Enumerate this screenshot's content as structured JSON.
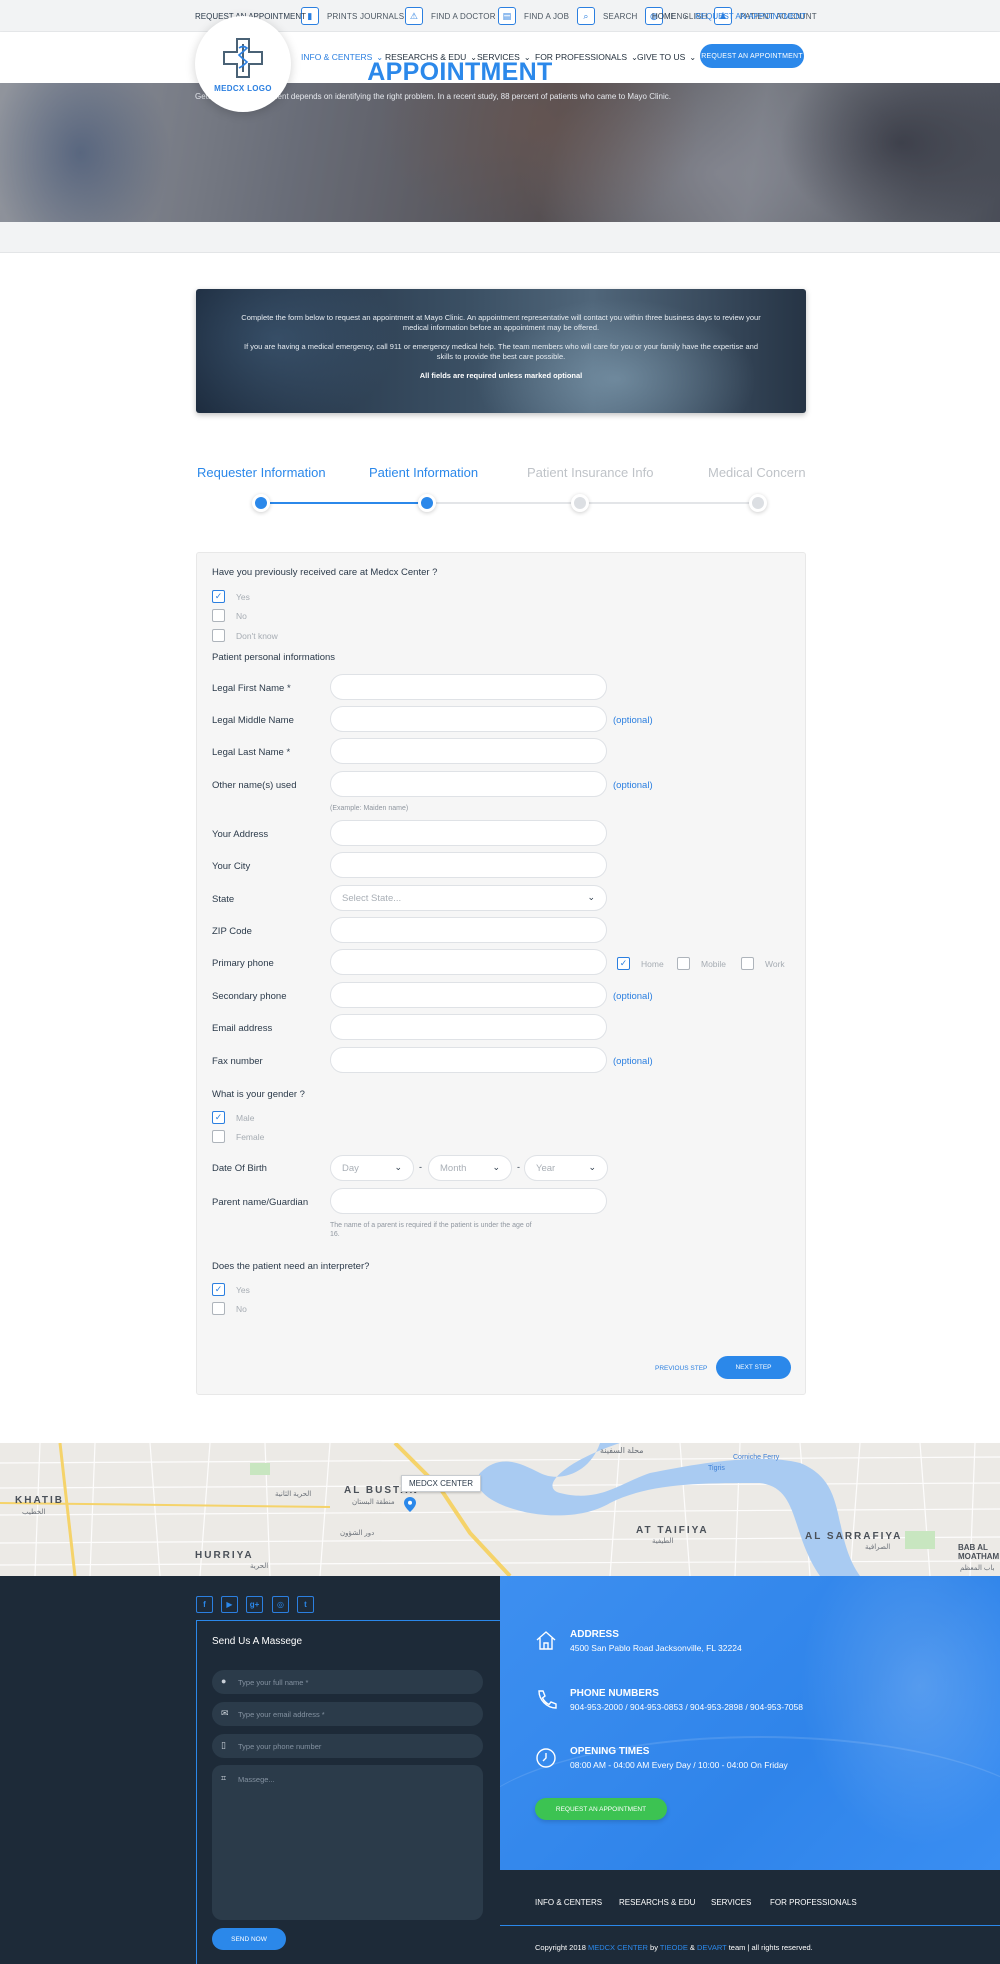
{
  "colors": {
    "accent": "#2b88ea",
    "dark": "#1d2a38",
    "green": "#3cc352"
  },
  "utility": [
    {
      "label": "PRINTS JOURNALS",
      "icon": "book-icon"
    },
    {
      "label": "FIND A DOCTOR",
      "icon": "doctor-icon"
    },
    {
      "label": "FIND A JOB",
      "icon": "document-icon"
    },
    {
      "label": "SEARCH",
      "icon": "search-icon"
    },
    {
      "label": "ENGLISH",
      "icon": "globe-icon"
    },
    {
      "label": "PATIENT ACCOUNT",
      "icon": "user-icon"
    }
  ],
  "logo": {
    "text": "MEDCX LOGO"
  },
  "nav": {
    "items": [
      "INFO & CENTERS",
      "RESEARCHS & EDU",
      "SERVICES",
      "FOR PROFESSIONALS",
      "GIVE TO US"
    ],
    "active": "INFO & CENTERS",
    "cta": "REQUEST AN APPOINTMENT"
  },
  "hero": {
    "title_main": "REQUEST AN ",
    "title_accent": "APPOINTMENT",
    "subtitle": "Getting effective treatment depends on identifying the right problem. In a recent study, 88 percent of patients who came to Mayo Clinic."
  },
  "breadcrumb": {
    "page": "REQUEST AN APPOINTMENT",
    "home": "HOME",
    "current": "REQUEST AN APPOINTMENT"
  },
  "intro": {
    "p1": "Complete the form below to request an appointment at Mayo Clinic. An appointment representative will contact you within three business days to review your medical information before an appointment may be offered.",
    "p2": "If you are having a medical emergency, call 911 or emergency medical help. The team members who will care for you or your family have the expertise and skills to provide the best care possible.",
    "p3": "All fields are required unless marked optional"
  },
  "steps": [
    {
      "label": "Requester Information",
      "active": true
    },
    {
      "label": "Patient Information",
      "active": true
    },
    {
      "label": "Patient Insurance Info",
      "active": false
    },
    {
      "label": "Medical Concern",
      "active": false
    }
  ],
  "form": {
    "q_previous_care": "Have you previously received care at Medcx Center ?",
    "care_options": [
      {
        "label": "Yes",
        "checked": true
      },
      {
        "label": "No",
        "checked": false
      },
      {
        "label": "Don't know",
        "checked": false
      }
    ],
    "section_personal": "Patient personal informations",
    "fields": {
      "first_name": "Legal First Name *",
      "middle_name": "Legal Middle Name",
      "last_name": "Legal Last Name *",
      "other_names": "Other name(s) used",
      "other_names_hint": "(Example: Maiden name)",
      "address": "Your Address",
      "city": "Your City",
      "state": "State",
      "state_placeholder": "Select State...",
      "zip": "ZIP Code",
      "primary_phone": "Primary phone",
      "secondary_phone": "Secondary phone",
      "email": "Email address",
      "fax": "Fax number",
      "dob": "Date Of Birth",
      "guardian": "Parent name/Guardian",
      "guardian_hint": "The name of a parent is required if the patient is under the age of 16."
    },
    "optional_label": "(optional)",
    "phone_types": [
      {
        "label": "Home",
        "checked": true
      },
      {
        "label": "Mobile",
        "checked": false
      },
      {
        "label": "Work",
        "checked": false
      }
    ],
    "q_gender": "What is your gender ?",
    "gender_options": [
      {
        "label": "Male",
        "checked": true
      },
      {
        "label": "Female",
        "checked": false
      }
    ],
    "dob_selects": {
      "day": "Day",
      "month": "Month",
      "year": "Year",
      "sep": "-"
    },
    "q_interpreter": "Does the patient need an interpreter?",
    "interpreter_options": [
      {
        "label": "Yes",
        "checked": true
      },
      {
        "label": "No",
        "checked": false
      }
    ],
    "prev_step": "PREVIOUS STEP",
    "next_step": "NEXT STEP"
  },
  "map": {
    "callout": "MEDCX CENTER",
    "labels": [
      "KHATIB",
      "الخطيب",
      "AL BUSTAN",
      "منطقة البستان",
      "HURRIYA",
      "الحرية",
      "AT TAIFIYA",
      "الطيفية",
      "AL SARRAFIYA",
      "الصرافية",
      "BAB AL MOATHAM",
      "باب المعظم",
      "محلة السفينة",
      "الحرية الثانية",
      "دور الشؤون",
      "Corniche Ferry",
      "Tigris"
    ]
  },
  "footer": {
    "social": [
      {
        "icon": "facebook-icon",
        "glyph": "f"
      },
      {
        "icon": "youtube-icon",
        "glyph": "▶"
      },
      {
        "icon": "google-plus-icon",
        "glyph": "g+"
      },
      {
        "icon": "instagram-icon",
        "glyph": "◎"
      },
      {
        "icon": "twitter-icon",
        "glyph": "t"
      }
    ],
    "contact_title": "Send Us A Massege",
    "placeholders": {
      "name": "Type your full name *",
      "email": "Type your email address *",
      "phone": "Type your phone number",
      "message": "Massege..."
    },
    "send": "SEND NOW",
    "address_title": "ADDRESS",
    "address": "4500 San Pablo Road Jacksonville, FL 32224",
    "phone_title": "PHONE NUMBERS",
    "phones": "904-953-2000 / 904-953-0853 / 904-953-2898 / 904-953-7058",
    "hours_title": "OPENING TIMES",
    "hours": "08:00 AM - 04:00 AM Every Day / 10:00 - 04:00 On Friday",
    "cta": "REQUEST AN APPOINTMENT",
    "nav": [
      "INFO & CENTERS",
      "RESEARCHS & EDU",
      "SERVICES",
      "FOR PROFESSIONALS"
    ],
    "copyright": {
      "prefix": "Copyright 2018 ",
      "brand": "MEDCX CENTER",
      "by": " by ",
      "a1": "TIEODE",
      "amp": " & ",
      "a2": "DEVART",
      "suffix": " team | all rights reserved."
    }
  }
}
